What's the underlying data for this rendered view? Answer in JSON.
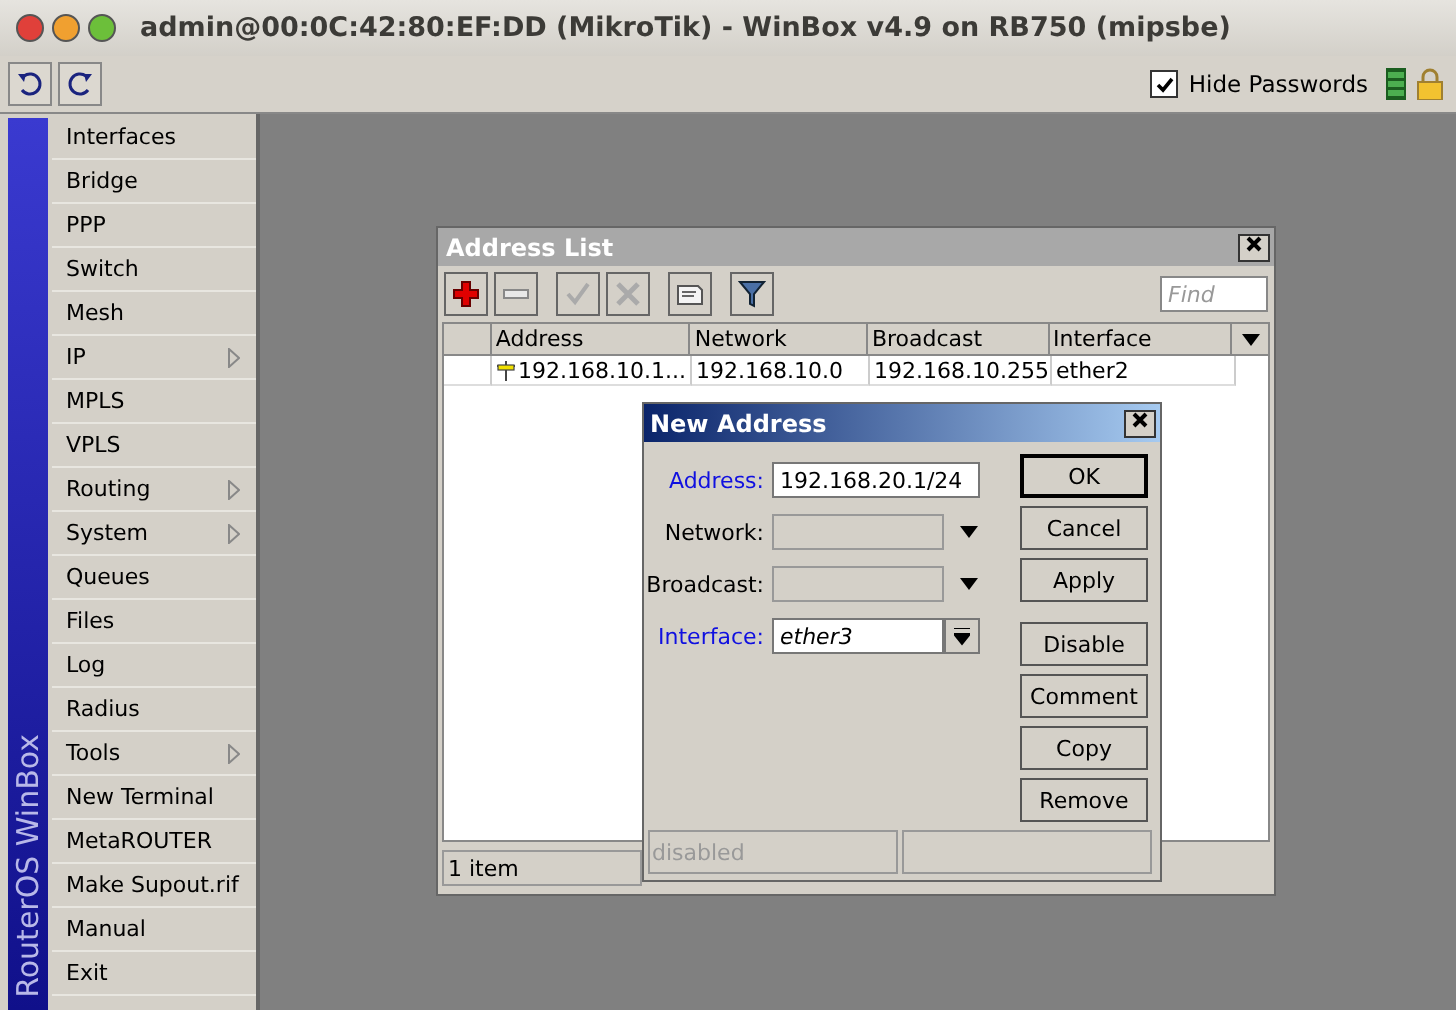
{
  "window": {
    "title": "admin@00:0C:42:80:EF:DD (MikroTik) - WinBox v4.9 on RB750 (mipsbe)"
  },
  "toolbar": {
    "hide_passwords": {
      "label": "Hide Passwords",
      "checked": true
    }
  },
  "sidebar": {
    "brand": "RouterOS WinBox",
    "items": [
      {
        "label": "Interfaces",
        "submenu": false
      },
      {
        "label": "Bridge",
        "submenu": false
      },
      {
        "label": "PPP",
        "submenu": false
      },
      {
        "label": "Switch",
        "submenu": false
      },
      {
        "label": "Mesh",
        "submenu": false
      },
      {
        "label": "IP",
        "submenu": true
      },
      {
        "label": "MPLS",
        "submenu": false
      },
      {
        "label": "VPLS",
        "submenu": false
      },
      {
        "label": "Routing",
        "submenu": true
      },
      {
        "label": "System",
        "submenu": true
      },
      {
        "label": "Queues",
        "submenu": false
      },
      {
        "label": "Files",
        "submenu": false
      },
      {
        "label": "Log",
        "submenu": false
      },
      {
        "label": "Radius",
        "submenu": false
      },
      {
        "label": "Tools",
        "submenu": true
      },
      {
        "label": "New Terminal",
        "submenu": false
      },
      {
        "label": "MetaROUTER",
        "submenu": false
      },
      {
        "label": "Make Supout.rif",
        "submenu": false
      },
      {
        "label": "Manual",
        "submenu": false
      },
      {
        "label": "Exit",
        "submenu": false
      }
    ]
  },
  "address_list": {
    "title": "Address List",
    "find_placeholder": "Find",
    "tools": [
      {
        "kind": "add",
        "disabled": false
      },
      {
        "kind": "remove",
        "disabled": false
      },
      {
        "kind": "enable",
        "disabled": true
      },
      {
        "kind": "disable",
        "disabled": true
      },
      {
        "kind": "comment",
        "disabled": false
      },
      {
        "kind": "filter",
        "disabled": false
      }
    ],
    "columns": [
      "Address",
      "Network",
      "Broadcast",
      "Interface"
    ],
    "rows": [
      {
        "cells": [
          "192.168.10.1...",
          "192.168.10.0",
          "192.168.10.255",
          "ether2"
        ]
      }
    ],
    "status": "1 item"
  },
  "new_address": {
    "title": "New Address",
    "fields": [
      {
        "label": "Address:",
        "value": "192.168.20.1/24",
        "kind": "text",
        "highlighted": true,
        "disabled": false
      },
      {
        "label": "Network:",
        "kind": "dropdown",
        "highlighted": false,
        "disabled": true
      },
      {
        "label": "Broadcast:",
        "kind": "dropdown",
        "highlighted": false,
        "disabled": true
      },
      {
        "label": "Interface:",
        "value": "ether3",
        "kind": "combo",
        "highlighted": true,
        "disabled": false
      }
    ],
    "buttons": [
      "OK",
      "Cancel",
      "Apply",
      "Disable",
      "Comment",
      "Copy",
      "Remove"
    ],
    "status": "disabled"
  }
}
